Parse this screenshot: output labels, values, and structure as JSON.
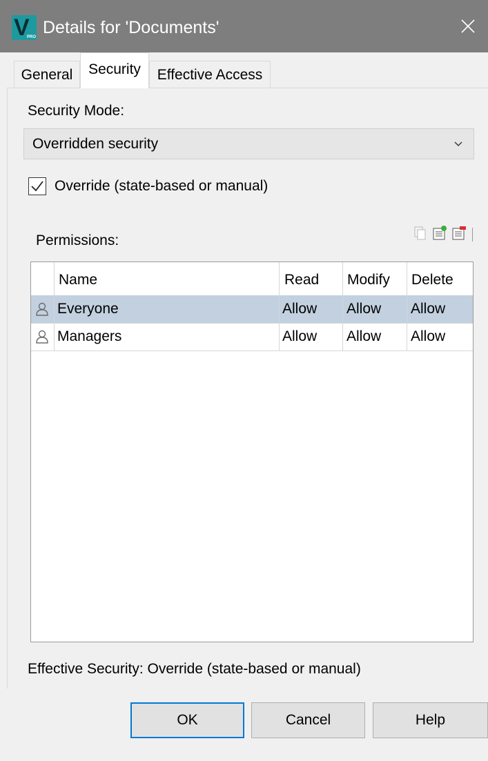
{
  "window": {
    "title": "Details for 'Documents'",
    "app_logo_letter": "V",
    "app_logo_sub": "PRO",
    "colors": {
      "titlebar": "#7e7e7e",
      "selection": "#c2d0e0",
      "default_button_border": "#0078d7"
    }
  },
  "tabs": [
    {
      "label": "General",
      "active": false
    },
    {
      "label": "Security",
      "active": true
    },
    {
      "label": "Effective Access",
      "active": false
    }
  ],
  "security": {
    "mode_label": "Security Mode:",
    "mode_value": "Overridden security",
    "override_checked": true,
    "override_label": "Override (state-based or manual)",
    "permissions_label": "Permissions:",
    "effective_security": "Effective Security: Override (state-based or manual)"
  },
  "toolbar_icons": [
    "copy-icon",
    "add-entry-icon",
    "remove-entry-icon"
  ],
  "permissions_table": {
    "columns": [
      "Name",
      "Read",
      "Modify",
      "Delete"
    ],
    "rows": [
      {
        "icon": "user-icon",
        "name": "Everyone",
        "read": "Allow",
        "modify": "Allow",
        "delete": "Allow",
        "selected": true
      },
      {
        "icon": "user-icon",
        "name": "Managers",
        "read": "Allow",
        "modify": "Allow",
        "delete": "Allow",
        "selected": false
      }
    ]
  },
  "buttons": {
    "ok": "OK",
    "cancel": "Cancel",
    "help": "Help"
  }
}
